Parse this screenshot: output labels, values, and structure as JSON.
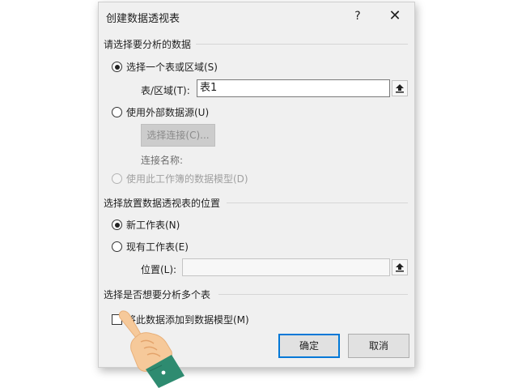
{
  "dialog": {
    "title": "创建数据透视表",
    "help_label": "?",
    "close_label": "✕"
  },
  "source_section": {
    "heading": "请选择要分析的数据",
    "option_range_label": "选择一个表或区域(S)",
    "range_field_label": "表/区域(T):",
    "range_field_value": "表1",
    "option_external_label": "使用外部数据源(U)",
    "choose_connection_label": "选择连接(C)...",
    "connection_name_label": "连接名称:",
    "option_datamodel_label": "使用此工作簿的数据模型(D)"
  },
  "placement_section": {
    "heading": "选择放置数据透视表的位置",
    "option_new_sheet_label": "新工作表(N)",
    "option_existing_sheet_label": "现有工作表(E)",
    "location_field_label": "位置(L):",
    "location_field_value": ""
  },
  "multi_table_section": {
    "heading": "选择是否想要分析多个表",
    "add_to_model_label": "将此数据添加到数据模型(M)"
  },
  "buttons": {
    "ok_label": "确定",
    "cancel_label": "取消"
  },
  "colors": {
    "dialog_bg": "#f0f0f0",
    "primary_border": "#0078d7",
    "hand_skin": "#f6c99a",
    "cuff": "#2e8b70"
  }
}
